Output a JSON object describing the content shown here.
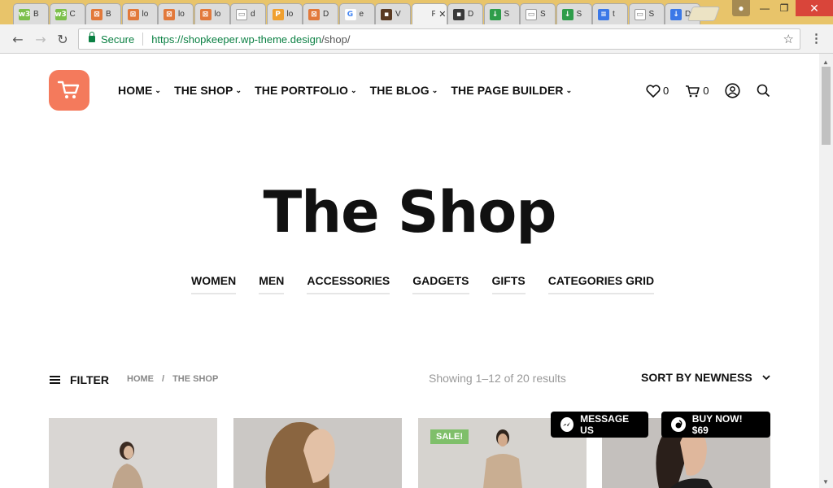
{
  "browser": {
    "tabs": [
      {
        "title": "B",
        "favicon": "w3-icon",
        "color": "#7cc04b"
      },
      {
        "title": "C",
        "favicon": "w3-icon",
        "color": "#7cc04b"
      },
      {
        "title": "B",
        "favicon": "xampp-icon",
        "color": "#e2793b"
      },
      {
        "title": "lo",
        "favicon": "xampp-icon",
        "color": "#e2793b"
      },
      {
        "title": "lo",
        "favicon": "xampp-icon",
        "color": "#e2793b"
      },
      {
        "title": "lo",
        "favicon": "xampp-icon",
        "color": "#e2793b"
      },
      {
        "title": "d",
        "favicon": "page-icon",
        "color": "#ffffff"
      },
      {
        "title": "lo",
        "favicon": "phpmyadmin-icon",
        "color": "#f0a030"
      },
      {
        "title": "D",
        "favicon": "xampp-icon",
        "color": "#e2793b"
      },
      {
        "title": "e",
        "favicon": "google-icon",
        "color": "#4285f4"
      },
      {
        "title": "V",
        "favicon": "photo-icon",
        "color": "#5a3a22"
      },
      {
        "title": "P",
        "favicon": "none",
        "color": "#f2f2f2"
      },
      {
        "title": "D",
        "favicon": "photo-icon",
        "color": "#3a3a3a"
      },
      {
        "title": "S",
        "favicon": "download-green-icon",
        "color": "#2e9d4a"
      },
      {
        "title": "S",
        "favicon": "page-icon",
        "color": "#ffffff"
      },
      {
        "title": "S",
        "favicon": "download-green-icon",
        "color": "#2e9d4a"
      },
      {
        "title": "t",
        "favicon": "doc-blue-icon",
        "color": "#3b78e7"
      },
      {
        "title": "S",
        "favicon": "page-icon",
        "color": "#ffffff"
      },
      {
        "title": "D",
        "favicon": "download-blue-icon",
        "color": "#3b78e7"
      }
    ],
    "secure_label": "Secure",
    "url_host": "https://shopkeeper.wp-theme.design",
    "url_path": "/shop/"
  },
  "header": {
    "nav": [
      "HOME",
      "THE SHOP",
      "THE PORTFOLIO",
      "THE BLOG",
      "THE PAGE BUILDER"
    ],
    "wishlist_count": "0",
    "cart_count": "0",
    "brand_color": "#f47a5c"
  },
  "page": {
    "title": "The Shop",
    "categories": [
      "WOMEN",
      "MEN",
      "ACCESSORIES",
      "GADGETS",
      "GIFTS",
      "CATEGORIES GRID"
    ],
    "filter_label": "FILTER",
    "breadcrumb": [
      "HOME",
      "/",
      "THE SHOP"
    ],
    "results_text": "Showing 1–12 of 20 results",
    "sort_label": "SORT BY NEWNESS",
    "sale_badge": "SALE!"
  },
  "floating": {
    "message_label": "MESSAGE US",
    "buy_label": "BUY NOW! $69"
  }
}
